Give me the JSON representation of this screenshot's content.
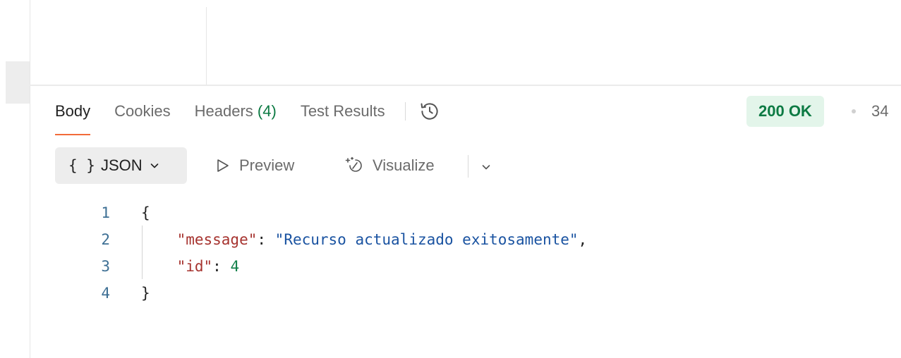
{
  "response_tabs": [
    {
      "label": "Body",
      "active": true
    },
    {
      "label": "Cookies",
      "active": false
    },
    {
      "label": "Headers",
      "count": "(4)",
      "active": false
    },
    {
      "label": "Test Results",
      "active": false
    }
  ],
  "status": {
    "code_text": "200 OK",
    "time_partial": "34",
    "color": "#0c7a43",
    "background": "#e3f5ea"
  },
  "toolbar": {
    "format_braces": "{ }",
    "format_label": "JSON",
    "preview_label": "Preview",
    "visualize_label": "Visualize"
  },
  "code": {
    "lines": [
      {
        "number": "1",
        "open": "{"
      },
      {
        "number": "2",
        "key": "\"message\"",
        "colon": ": ",
        "value": "\"Recurso actualizado exitosamente\"",
        "trail": ","
      },
      {
        "number": "3",
        "key": "\"id\"",
        "colon": ": ",
        "value": "4",
        "trail": ""
      },
      {
        "number": "4",
        "close": "}"
      }
    ]
  },
  "colors": {
    "accent": "#f26b3a",
    "success": "#0c7a43",
    "json_key": "#a6332f",
    "json_string": "#1a53a1",
    "json_number": "#13804a"
  }
}
